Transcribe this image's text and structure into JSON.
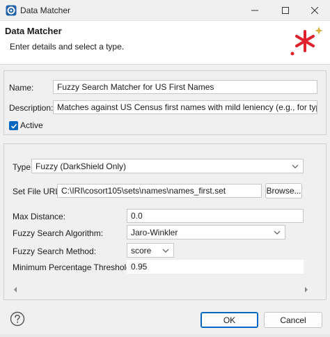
{
  "window": {
    "title": "Data Matcher"
  },
  "header": {
    "title": "Data Matcher",
    "subtitle": "Enter details and select a type."
  },
  "general": {
    "name_label": "Name:",
    "name_value": "Fuzzy Search Matcher for US First Names",
    "description_label": "Description:",
    "description_value": "Matches against US Census first names with mild leniency (e.g., for typos).",
    "active_label": "Active",
    "active_checked": true
  },
  "details": {
    "type_label": "Type:",
    "type_value": "Fuzzy (DarkShield Only)",
    "set_file_label": "Set File URL:",
    "set_file_value": "C:\\IRI\\cosort105\\sets\\names\\names_first.set",
    "browse_label": "Browse...",
    "max_distance_label": "Max Distance:",
    "max_distance_value": "0.0",
    "algorithm_label": "Fuzzy Search Algorithm:",
    "algorithm_value": "Jaro-Winkler",
    "method_label": "Fuzzy Search Method:",
    "method_value": "score",
    "threshold_label": "Minimum Percentage Threshold:",
    "threshold_value": "0.95"
  },
  "footer": {
    "ok_label": "OK",
    "cancel_label": "Cancel"
  },
  "colors": {
    "accent": "#0067c0",
    "logo_red": "#e0202a",
    "logo_gold": "#d8b040"
  },
  "icons": [
    "app-icon",
    "minimize-icon",
    "maximize-icon",
    "close-icon",
    "logo-asterisk-icon",
    "check-icon",
    "chevron-down-icon",
    "scroll-left-icon",
    "scroll-right-icon",
    "help-icon"
  ]
}
